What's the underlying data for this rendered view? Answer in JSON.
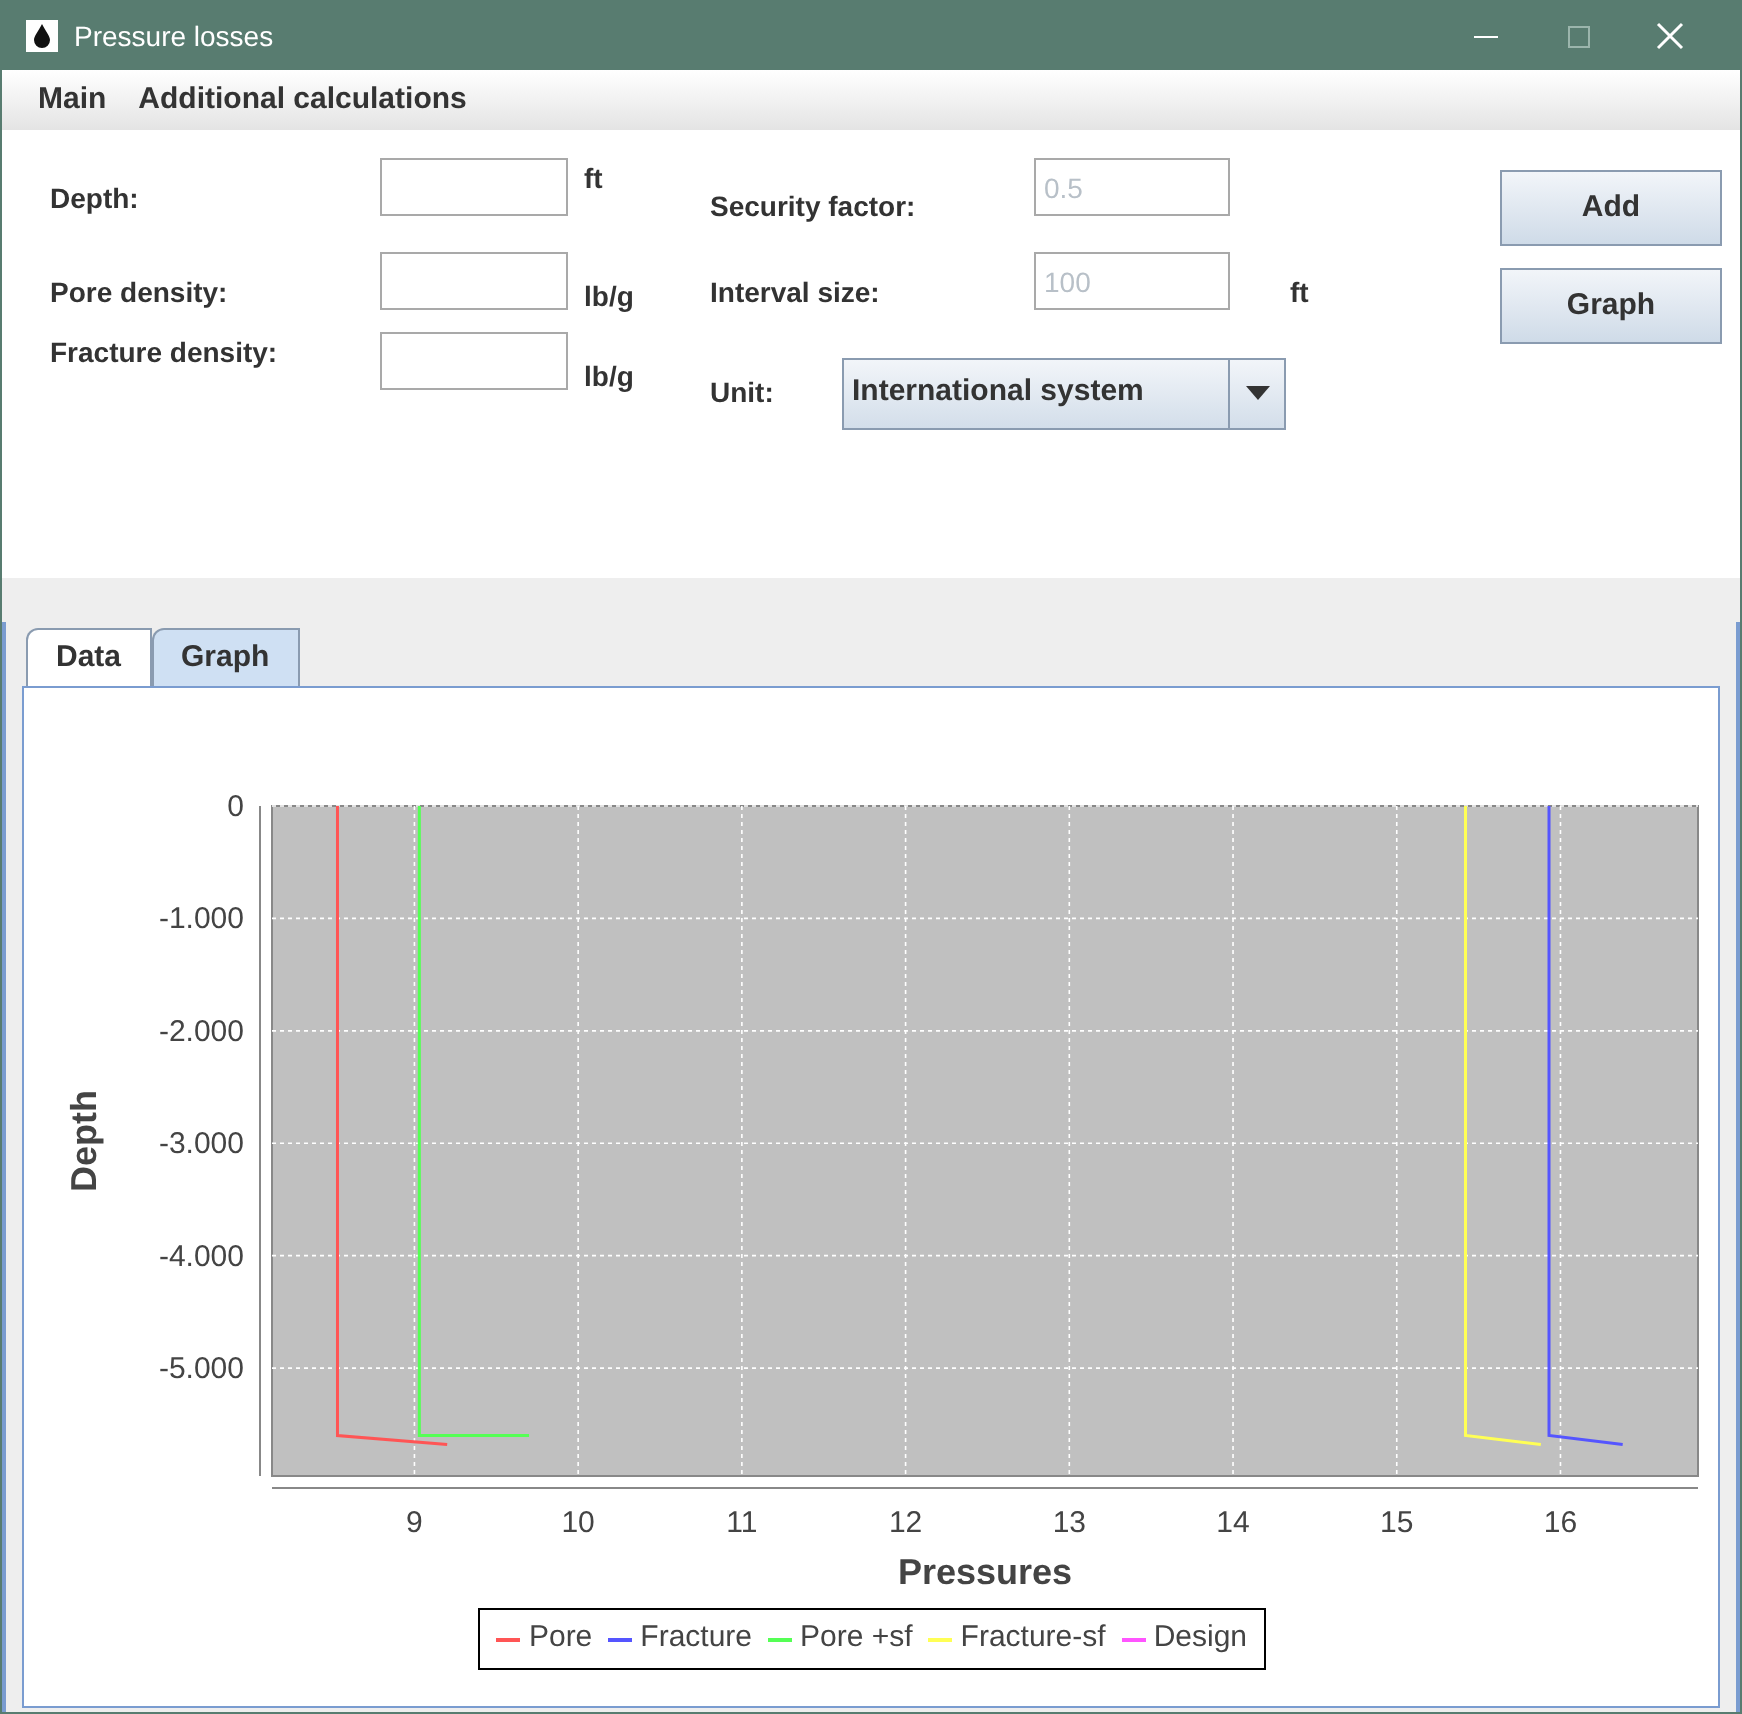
{
  "window": {
    "title": "Pressure losses"
  },
  "menu": [
    "Main",
    "Additional calculations"
  ],
  "form": {
    "left": [
      {
        "label": "Depth:",
        "unit": "ft"
      },
      {
        "label": "Pore density:",
        "unit": "lb/g"
      },
      {
        "label": "Fracture density:",
        "unit": "lb/g"
      }
    ],
    "security_factor": {
      "label": "Security factor:",
      "value": "0.5",
      "disabled": true
    },
    "interval_size": {
      "label": "Interval size:",
      "value": "100",
      "unit": "ft",
      "disabled": true
    },
    "unit": {
      "label": "Unit:",
      "value": "International system"
    },
    "buttons": [
      "Add",
      "Graph"
    ]
  },
  "tabs": [
    {
      "label": "Data",
      "selected": false
    },
    {
      "label": "Graph",
      "selected": true
    }
  ],
  "graph": {
    "chart_data": {
      "type": "line",
      "grid": true,
      "legend": "bottom",
      "xlabel": "Pressures",
      "ylabel": "Depth",
      "xlim": [
        8.13,
        16.84
      ],
      "ylim": [
        -5.96,
        0
      ],
      "xticks": [
        9,
        10,
        11,
        12,
        13,
        14,
        15,
        16
      ],
      "yticks": [
        {
          "value": 0,
          "label": "0"
        },
        {
          "value": -1,
          "label": "-1.000"
        },
        {
          "value": -2,
          "label": "-2.000"
        },
        {
          "value": -3,
          "label": "-3.000"
        },
        {
          "value": -4,
          "label": "-4.000"
        },
        {
          "value": -5,
          "label": "-5.000"
        }
      ],
      "series": [
        {
          "name": "Pore",
          "color": "#ff5555",
          "x": [
            8.53,
            8.53,
            9.2
          ],
          "values": [
            0,
            -5.6,
            -5.68
          ]
        },
        {
          "name": "Fracture",
          "color": "#5555ff",
          "x": [
            15.93,
            15.93,
            16.38
          ],
          "values": [
            0,
            -5.6,
            -5.68
          ]
        },
        {
          "name": "Pore +sf",
          "color": "#55ff55",
          "x": [
            9.03,
            9.03,
            9.7
          ],
          "values": [
            0,
            -5.6,
            -5.6
          ]
        },
        {
          "name": "Fracture-sf",
          "color": "#ffff55",
          "x": [
            15.42,
            15.42,
            15.88
          ],
          "values": [
            0,
            -5.6,
            -5.68
          ]
        },
        {
          "name": "Design",
          "color": "#ff55ff"
        }
      ]
    }
  }
}
